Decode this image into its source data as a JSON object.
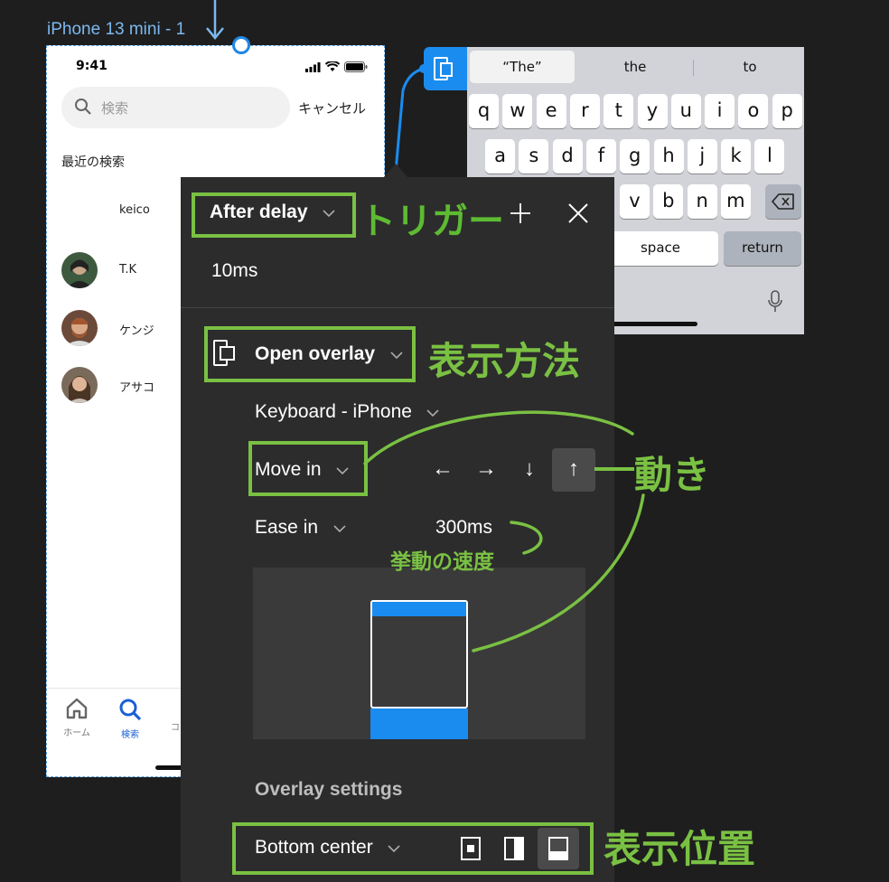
{
  "canvas": {
    "frame_label": "iPhone 13 mini - 1",
    "colors": {
      "accent_blue": "#1a8cf0",
      "annotation_green": "#7ac143",
      "panel_bg": "#2c2c2c"
    }
  },
  "phone": {
    "status_time": "9:41",
    "search_placeholder": "検索",
    "cancel_label": "キャンセル",
    "recent_title": "最近の検索",
    "users": [
      {
        "name": "keico",
        "has_avatar": false
      },
      {
        "name": "T.K",
        "has_avatar": true
      },
      {
        "name": "ケンジ",
        "has_avatar": true
      },
      {
        "name": "アサコ",
        "has_avatar": true
      }
    ],
    "tabs": [
      {
        "label": "ホーム",
        "icon": "home-icon",
        "active": false
      },
      {
        "label": "検索",
        "icon": "search-icon",
        "active": true
      },
      {
        "label": "コ",
        "icon": "partial-icon",
        "active": false
      }
    ]
  },
  "keyboard": {
    "suggestions": [
      "“The”",
      "the",
      "to"
    ],
    "row1": [
      "q",
      "w",
      "e",
      "r",
      "t",
      "y",
      "u",
      "i",
      "o",
      "p"
    ],
    "row2": [
      "a",
      "s",
      "d",
      "f",
      "g",
      "h",
      "j",
      "k",
      "l"
    ],
    "row3": [
      "v",
      "b",
      "n",
      "m"
    ],
    "space_label": "space",
    "return_label": "return"
  },
  "panel": {
    "trigger": "After delay",
    "delay": "10ms",
    "action": "Open overlay",
    "destination": "Keyboard - iPhone",
    "animation": "Move in",
    "directions": [
      "←",
      "→",
      "↓",
      "↑"
    ],
    "selected_direction": "↑",
    "easing": "Ease in",
    "duration": "300ms",
    "overlay_settings_title": "Overlay settings",
    "position": "Bottom center",
    "selected_position_option": "bottom"
  },
  "annotations": {
    "trigger": "トリガー",
    "display_method": "表示方法",
    "motion": "動き",
    "speed": "挙動の速度",
    "display_position": "表示位置"
  }
}
